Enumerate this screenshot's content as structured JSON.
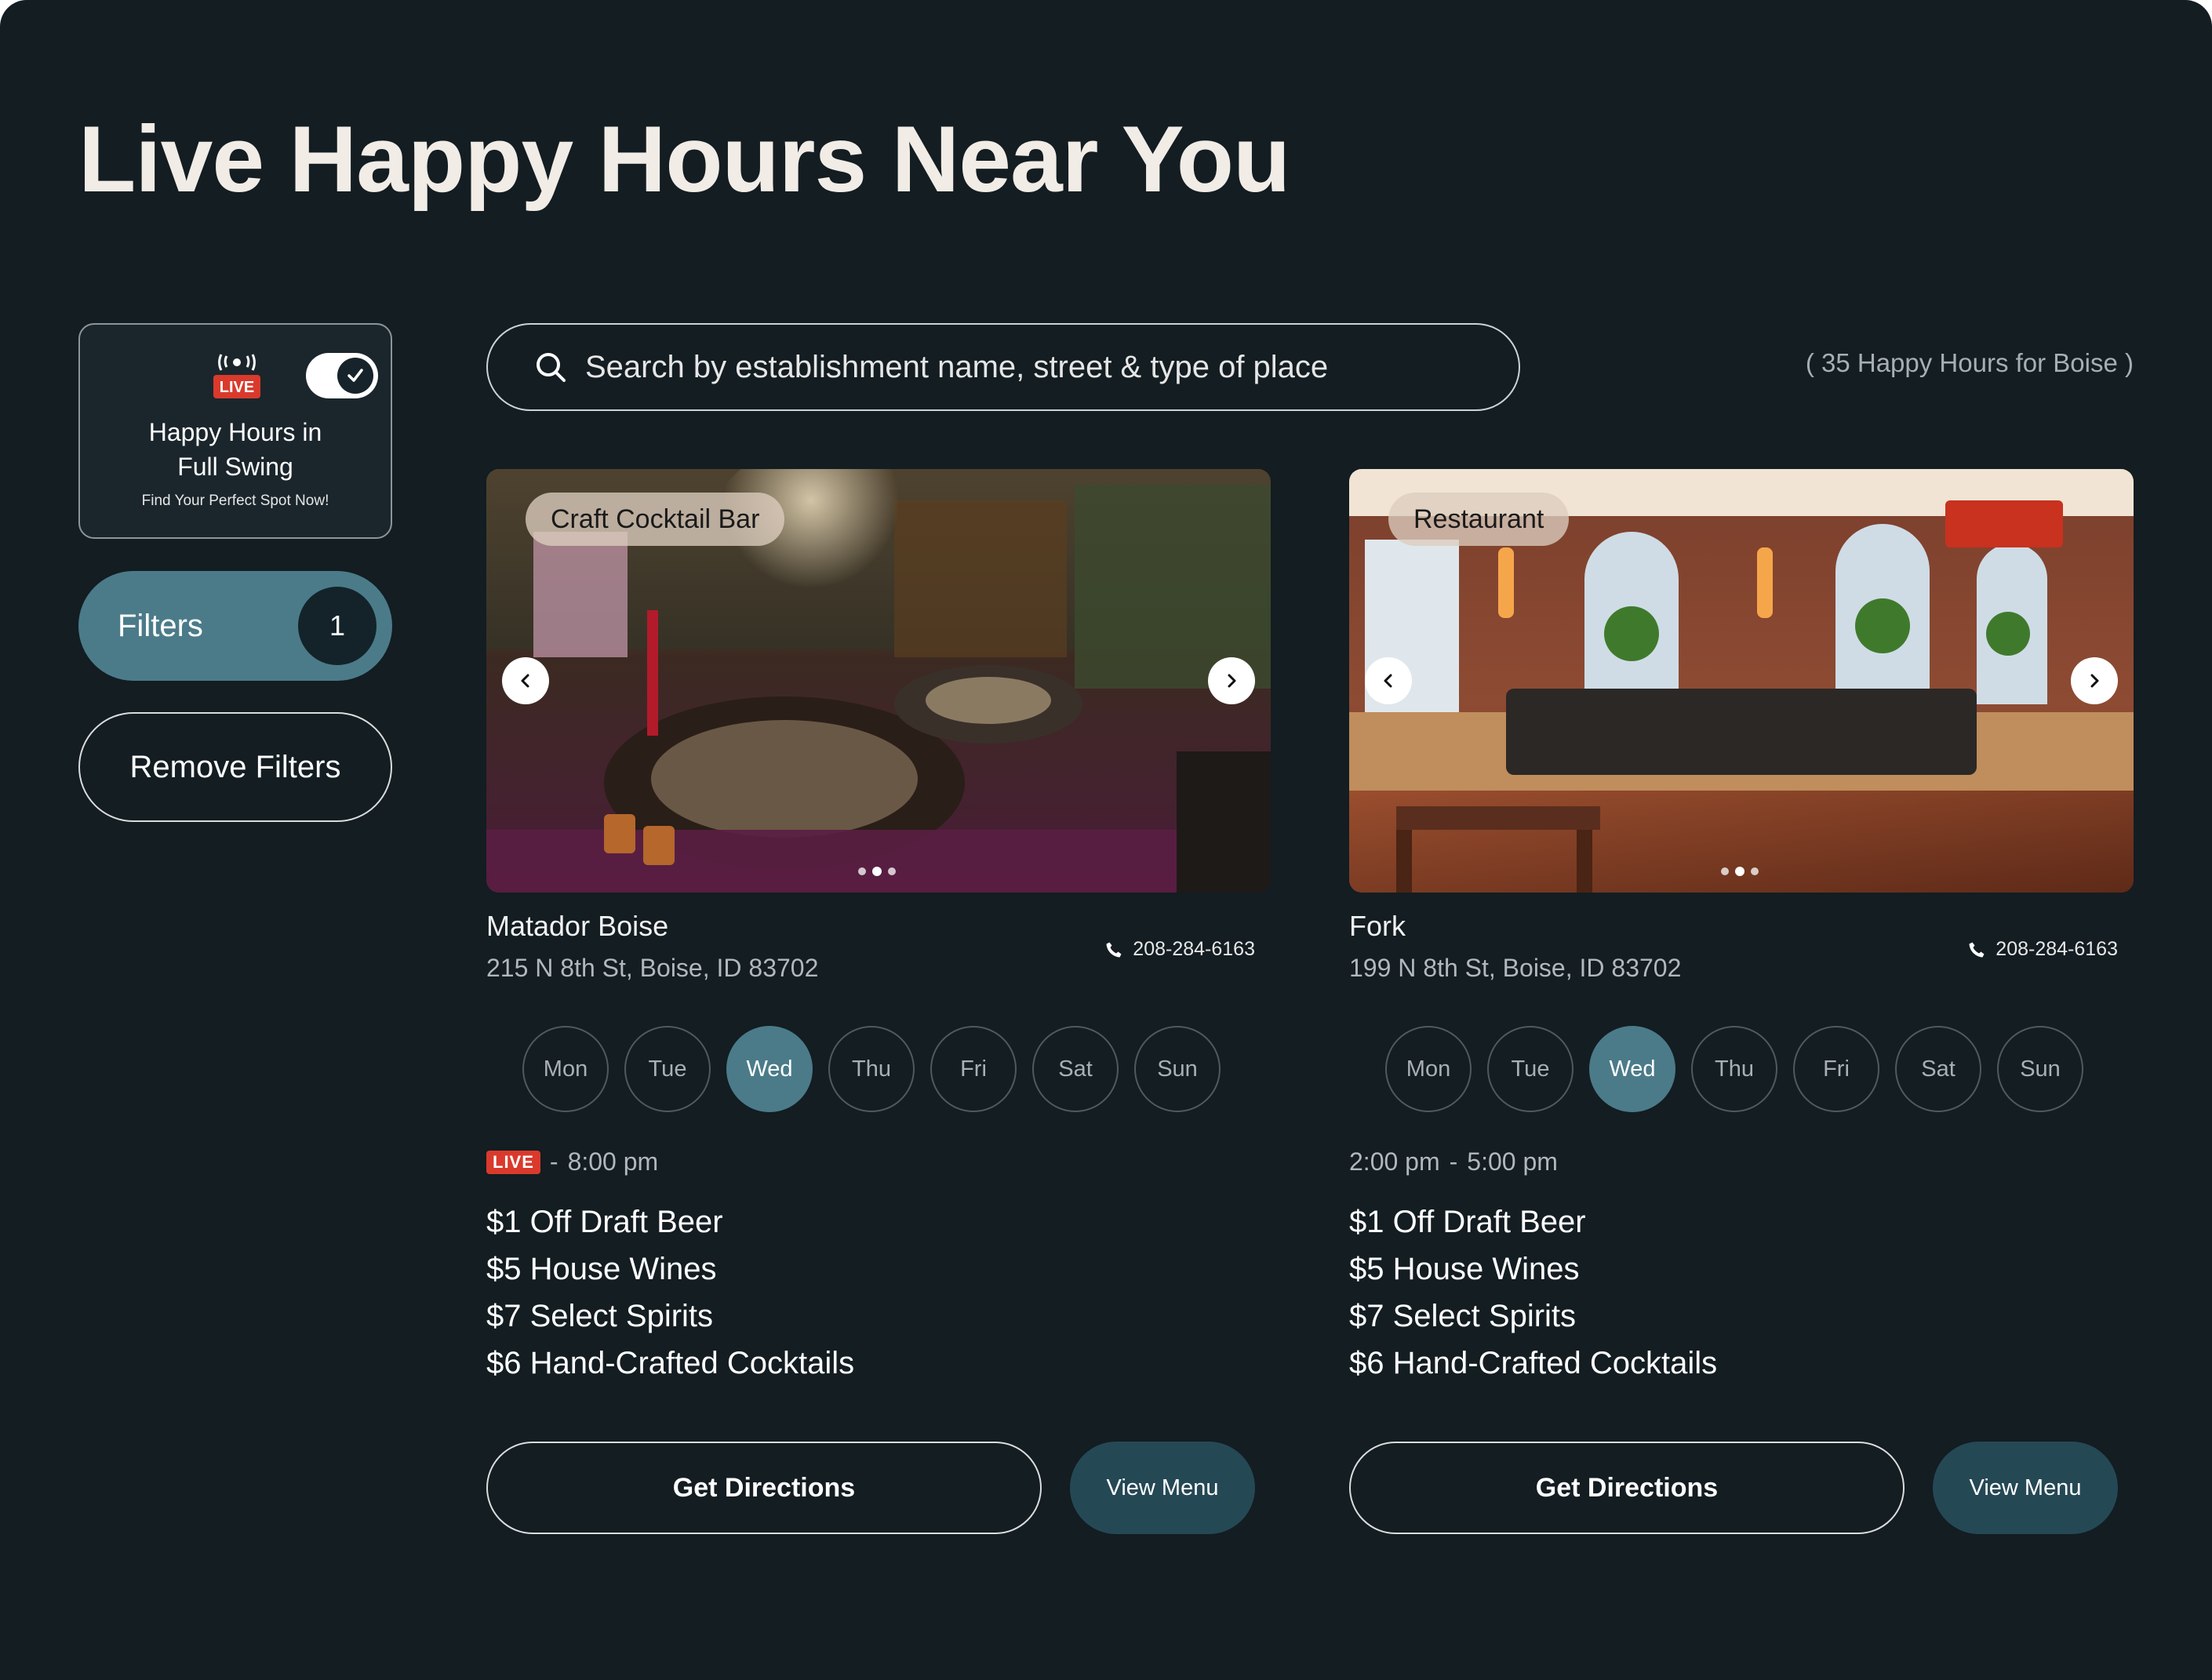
{
  "page": {
    "title": "Live Happy Hours Near You"
  },
  "sidebar": {
    "live_card": {
      "badge_text": "LIVE",
      "title_line1": "Happy Hours in",
      "title_line2": "Full Swing",
      "subtitle": "Find Your Perfect Spot Now!",
      "toggle_on": true
    },
    "filters": {
      "label": "Filters",
      "count": "1"
    },
    "remove_filters_label": "Remove Filters"
  },
  "search": {
    "placeholder": "Search by establishment name, street & type of place",
    "value": "",
    "result_count": "( 35 Happy Hours for Boise )"
  },
  "colors": {
    "background": "#131d22",
    "accent": "#4b7b89",
    "menu_button": "#254855",
    "live_red": "#d93a2c"
  },
  "cards": [
    {
      "category": "Craft Cocktail Bar",
      "name": "Matador Boise",
      "address": "215 N 8th St, Boise, ID 83702",
      "phone": "208-284-6163",
      "photo_index": 1,
      "photo_count": 3,
      "days": [
        "Mon",
        "Tue",
        "Wed",
        "Thu",
        "Fri",
        "Sat",
        "Sun"
      ],
      "active_day": "Wed",
      "is_live": true,
      "live_label": "LIVE",
      "hours_start": "",
      "hours_end": "8:00 pm",
      "specials": [
        "$1 Off Draft Beer",
        "$5 House Wines",
        "$7 Select Spirits",
        "$6 Hand-Crafted Cocktails"
      ],
      "directions_label": "Get Directions",
      "menu_label": "View Menu"
    },
    {
      "category": "Restaurant",
      "name": "Fork",
      "address": "199 N 8th St, Boise, ID 83702",
      "phone": "208-284-6163",
      "photo_index": 1,
      "photo_count": 3,
      "days": [
        "Mon",
        "Tue",
        "Wed",
        "Thu",
        "Fri",
        "Sat",
        "Sun"
      ],
      "active_day": "Wed",
      "is_live": false,
      "live_label": "",
      "hours_start": "2:00 pm",
      "hours_end": "5:00 pm",
      "specials": [
        "$1 Off Draft Beer",
        "$5 House Wines",
        "$7 Select Spirits",
        "$6 Hand-Crafted Cocktails"
      ],
      "directions_label": "Get Directions",
      "menu_label": "View Menu"
    }
  ]
}
